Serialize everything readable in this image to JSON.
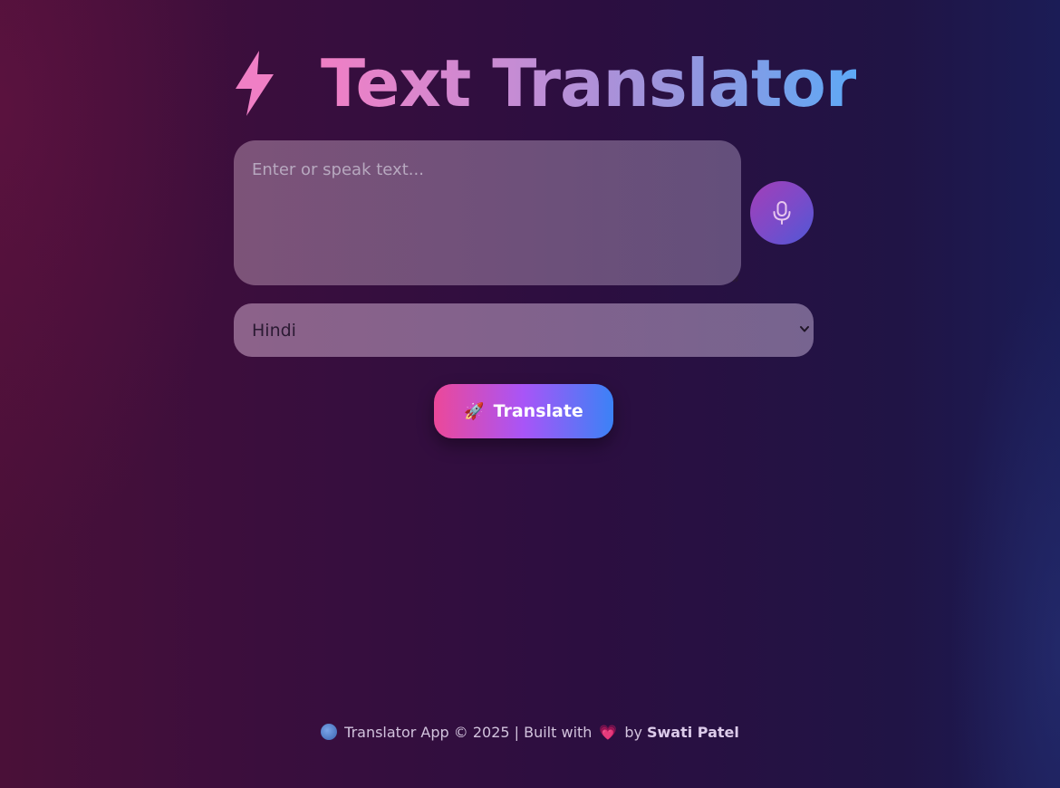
{
  "header": {
    "icon": "lightning-bolt-icon",
    "title": "Text Translator"
  },
  "input": {
    "placeholder": "Enter or speak text...",
    "value": ""
  },
  "mic": {
    "icon": "microphone-icon"
  },
  "language_select": {
    "selected": "Hindi",
    "icon": "chevron-down-icon"
  },
  "translate_button": {
    "icon": "🚀",
    "label": "Translate"
  },
  "footer": {
    "globe_icon": "globe-icon",
    "text_before": "Translator App © 2025 | Built with",
    "heart": "💗",
    "by": "by",
    "author": "Swati Patel"
  },
  "colors": {
    "title_gradient": [
      "#f07fc5",
      "#5ea9f6"
    ],
    "bolt": "#f07fc5",
    "button_gradient": [
      "#ec4899",
      "#a855f7",
      "#3b82f6"
    ],
    "mic_gradient": [
      "#a23fb8",
      "#5058d6"
    ]
  }
}
